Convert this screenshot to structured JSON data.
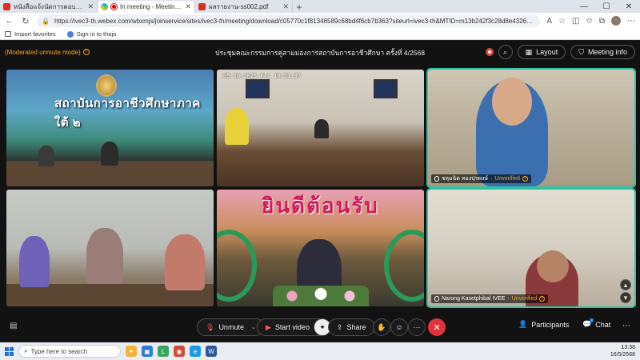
{
  "browser": {
    "tabs": [
      {
        "title": "หนังสือแจ้งนัดการตอบตอน.pdf",
        "icon": "pdf-icon",
        "active": false
      },
      {
        "title": "In meeting - Meeting - Webex",
        "icon": "webex-icon",
        "active": true
      },
      {
        "title": "ผลรายงาน-ss002.pdf",
        "icon": "pdf-icon",
        "active": false
      }
    ],
    "url": "https://ivec3-th.webex.com/wbxmjs/joinservice/sites/ivec3-th/meeting/download/c05770c1f81346589c68bd4f6cb7b363?siteurl=ivec3-th&MTID=m13b242f3c28d8e4326b3cf0588c25865",
    "bookmarks": [
      {
        "label": "Import favorites"
      },
      {
        "label": "Sign in to thajo"
      }
    ]
  },
  "meeting": {
    "moderated_mode": "(Moderated unmute mode)",
    "title": "ประชุมคณะกรรมการคู่สามมองการสถาบันการอาชีวศึกษา ครั้งที่ 4/2568",
    "layout_label": "Layout",
    "meeting_info_label": "Meeting info",
    "tiles": [
      {
        "sign": "สถาบันการอาชีวศึกษาภาคใต้ ๒",
        "name": ""
      },
      {
        "timestamp": "05-16-2025 Fri 10:51:37",
        "name": ""
      },
      {
        "name": "ชลุมฉิต ทองปุรพงษ์",
        "status": "Unverified",
        "active": true
      },
      {
        "name": ""
      },
      {
        "banner": "ยินดีต้อนรับ",
        "name": ""
      },
      {
        "name": "Narong Kasetphibal IVEE",
        "status": "Unverified",
        "active": true
      }
    ],
    "controls": {
      "unmute": "Unmute",
      "start_video": "Start video",
      "share": "Share",
      "participants": "Participants",
      "chat": "Chat",
      "more": "···"
    }
  },
  "taskbar": {
    "search_placeholder": "Type here to search",
    "time": "13:38",
    "date": "16/5/2568"
  },
  "colors": {
    "accent_teal": "#2fc4a4",
    "moderated_orange": "#f5a623",
    "end_call_red": "#e0343a"
  }
}
